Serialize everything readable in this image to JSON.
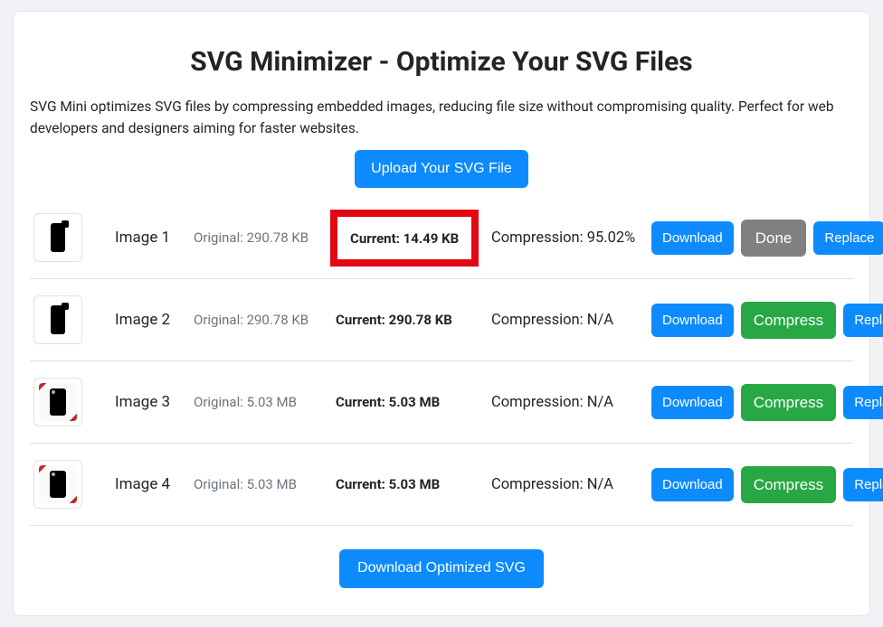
{
  "header": {
    "title": "SVG Minimizer - Optimize Your SVG Files",
    "description": "SVG Mini optimizes SVG files by compressing embedded images, reducing file size without compromising quality. Perfect for web developers and designers aiming for faster websites.",
    "uploadButton": "Upload Your SVG File"
  },
  "rows": {
    "0": {
      "name": "Image 1",
      "original": "Original: 290.78 KB",
      "current": "Current: 14.49 KB",
      "compression": "Compression: 95.02%",
      "download": "Download",
      "secondary": "Done",
      "replace": "Replace"
    },
    "1": {
      "name": "Image 2",
      "original": "Original: 290.78 KB",
      "current": "Current: 290.78 KB",
      "compression": "Compression: N/A",
      "download": "Download",
      "secondary": "Compress",
      "replace": "Replace"
    },
    "2": {
      "name": "Image 3",
      "original": "Original: 5.03 MB",
      "current": "Current: 5.03 MB",
      "compression": "Compression: N/A",
      "download": "Download",
      "secondary": "Compress",
      "replace": "Replace"
    },
    "3": {
      "name": "Image 4",
      "original": "Original: 5.03 MB",
      "current": "Current: 5.03 MB",
      "compression": "Compression: N/A",
      "download": "Download",
      "secondary": "Compress",
      "replace": "Replace"
    }
  },
  "footer": {
    "downloadAll": "Download Optimized SVG"
  }
}
